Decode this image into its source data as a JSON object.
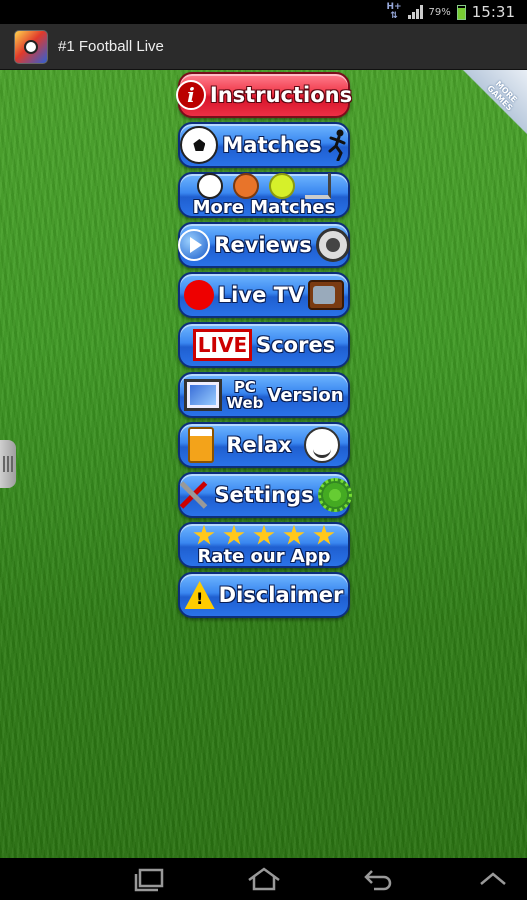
{
  "status_bar": {
    "network": "H+",
    "battery_percent": "79%",
    "battery_level": 0.79,
    "time": "15:31"
  },
  "action_bar": {
    "title": "#1 Football Live",
    "icon": "app-logo-icon"
  },
  "corner_badge": "MORE GAMES",
  "menu": [
    {
      "label": "Instructions",
      "style": "red",
      "icon": "info-icon"
    },
    {
      "label": "Matches",
      "icon": "football-icon",
      "icon_right": "player-kicking-icon"
    },
    {
      "label": "More Matches",
      "icons": [
        "football-icon",
        "basketball-icon",
        "tennis-ball-icon",
        "hockey-stick-icon"
      ]
    },
    {
      "label": "Reviews",
      "icon": "play-icon",
      "icon_right": "film-reel-icon"
    },
    {
      "label": "Live TV",
      "icon": "record-dot-icon",
      "icon_right": "tv-icon"
    },
    {
      "label": "Scores",
      "badge": "LIVE"
    },
    {
      "label_lines": [
        "PC",
        "Web"
      ],
      "label": "Version",
      "icon": "computer-monitor-icon"
    },
    {
      "label": "Relax",
      "icon": "beer-mug-icon",
      "icon_right": "troll-face-icon"
    },
    {
      "label": "Settings",
      "icon": "tools-icon",
      "icon_right": "gear-icon"
    },
    {
      "label": "Rate our App",
      "icons": [
        "star-icon",
        "star-icon",
        "star-icon",
        "star-icon",
        "star-icon"
      ]
    },
    {
      "label": "Disclaimer",
      "icon": "warning-icon"
    }
  ],
  "nav_bar": [
    "recent-apps-icon",
    "home-icon",
    "back-icon",
    "up-chevron-icon"
  ],
  "colors": {
    "button_blue": "#2a72e8",
    "button_red": "#ec2f45",
    "grass": "#3f9a24",
    "action_bar": "#2b2b2b"
  }
}
